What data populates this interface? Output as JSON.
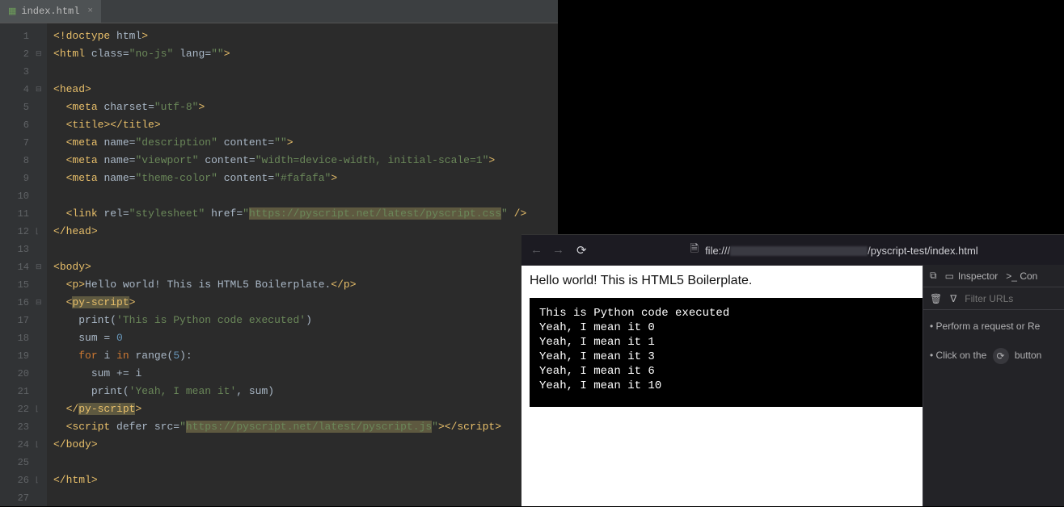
{
  "editor": {
    "tab": {
      "filename": "index.html"
    },
    "lines": [
      {
        "n": 1,
        "fold": "",
        "html": "<span class='tag-angle'>&lt;!</span><span class='tag-name'>doctype</span> <span class='attr-name'>html</span><span class='tag-angle'>&gt;</span>"
      },
      {
        "n": 2,
        "fold": "⊟",
        "html": "<span class='tag-angle'>&lt;</span><span class='tag-name'>html</span> <span class='attr-name'>class</span>=<span class='attr-val'>\"no-js\"</span> <span class='attr-name'>lang</span>=<span class='attr-val'>\"\"</span><span class='tag-angle'>&gt;</span>"
      },
      {
        "n": 3,
        "fold": "",
        "html": ""
      },
      {
        "n": 4,
        "fold": "⊟",
        "html": "<span class='tag-angle'>&lt;</span><span class='tag-name'>head</span><span class='tag-angle'>&gt;</span>"
      },
      {
        "n": 5,
        "fold": "",
        "html": "  <span class='tag-angle'>&lt;</span><span class='tag-name'>meta</span> <span class='attr-name'>charset</span>=<span class='attr-val'>\"utf-8\"</span><span class='tag-angle'>&gt;</span>"
      },
      {
        "n": 6,
        "fold": "",
        "html": "  <span class='tag-angle'>&lt;</span><span class='tag-name'>title</span><span class='tag-angle'>&gt;&lt;/</span><span class='tag-name'>title</span><span class='tag-angle'>&gt;</span>"
      },
      {
        "n": 7,
        "fold": "",
        "html": "  <span class='tag-angle'>&lt;</span><span class='tag-name'>meta</span> <span class='attr-name'>name</span>=<span class='attr-val'>\"description\"</span> <span class='attr-name'>content</span>=<span class='attr-val'>\"\"</span><span class='tag-angle'>&gt;</span>"
      },
      {
        "n": 8,
        "fold": "",
        "html": "  <span class='tag-angle'>&lt;</span><span class='tag-name'>meta</span> <span class='attr-name'>name</span>=<span class='attr-val'>\"viewport\"</span> <span class='attr-name'>content</span>=<span class='attr-val'>\"width=device-width, initial-scale=1\"</span><span class='tag-angle'>&gt;</span>"
      },
      {
        "n": 9,
        "fold": "",
        "html": "  <span class='tag-angle'>&lt;</span><span class='tag-name'>meta</span> <span class='attr-name'>name</span>=<span class='attr-val'>\"theme-color\"</span> <span class='attr-name'>content</span>=<span class='attr-val'>\"#fafafa\"</span><span class='tag-angle'>&gt;</span>"
      },
      {
        "n": 10,
        "fold": "",
        "html": ""
      },
      {
        "n": 11,
        "fold": "",
        "html": "  <span class='tag-angle'>&lt;</span><span class='tag-name'>link</span> <span class='attr-name'>rel</span>=<span class='attr-val'>\"stylesheet\"</span> <span class='attr-name'>href</span>=<span class='attr-val'>\"<span class='hl-soft'>https://pyscript.net/latest/pyscript.css</span>\"</span> <span class='tag-angle'>/&gt;</span>"
      },
      {
        "n": 12,
        "fold": "⌊",
        "html": "<span class='tag-angle'>&lt;/</span><span class='tag-name'>head</span><span class='tag-angle'>&gt;</span>"
      },
      {
        "n": 13,
        "fold": "",
        "html": ""
      },
      {
        "n": 14,
        "fold": "⊟",
        "html": "<span class='tag-angle'>&lt;</span><span class='tag-name'>body</span><span class='tag-angle'>&gt;</span>"
      },
      {
        "n": 15,
        "fold": "",
        "html": "  <span class='tag-angle'>&lt;</span><span class='tag-name'>p</span><span class='tag-angle'>&gt;</span><span class='text-node'>Hello world! This is HTML5 Boilerplate.</span><span class='tag-angle'>&lt;/</span><span class='tag-name'>p</span><span class='tag-angle'>&gt;</span>"
      },
      {
        "n": 16,
        "fold": "⊟",
        "html": "  <span class='tag-angle'>&lt;</span><span class='custom-tag'>py-script</span><span class='tag-angle'>&gt;</span>"
      },
      {
        "n": 17,
        "fold": "",
        "html": "    <span class='py-id'>print</span>(<span class='py-str'>'This is Python code executed'</span>)"
      },
      {
        "n": 18,
        "fold": "",
        "html": "    <span class='py-id'>sum</span> = <span class='py-num'>0</span>"
      },
      {
        "n": 19,
        "fold": "",
        "html": "    <span class='py-kw'>for</span> <span class='py-id'>i</span> <span class='py-kw'>in</span> <span class='py-id'>range</span>(<span class='py-num'>5</span>):"
      },
      {
        "n": 20,
        "fold": "",
        "html": "      <span class='py-id'>sum</span> += <span class='py-id'>i</span>"
      },
      {
        "n": 21,
        "fold": "",
        "html": "      <span class='py-id'>print</span>(<span class='py-str'>'Yeah, I mean it'</span>, <span class='py-id'>sum</span>)"
      },
      {
        "n": 22,
        "fold": "⌊",
        "html": "  <span class='tag-angle'>&lt;/</span><span class='custom-tag'>py-script</span><span class='tag-angle'>&gt;</span>"
      },
      {
        "n": 23,
        "fold": "",
        "html": "  <span class='tag-angle'>&lt;</span><span class='tag-name'>script</span> <span class='attr-name'>defer</span> <span class='attr-name'>src</span>=<span class='attr-val'>\"<span class='hl-soft'>https://pyscript.net/latest/pyscript.js</span>\"</span><span class='tag-angle'>&gt;&lt;/</span><span class='tag-name'>script</span><span class='tag-angle'>&gt;</span>"
      },
      {
        "n": 24,
        "fold": "⌊",
        "html": "<span class='tag-angle'>&lt;/</span><span class='tag-name'>body</span><span class='tag-angle'>&gt;</span>"
      },
      {
        "n": 25,
        "fold": "",
        "html": ""
      },
      {
        "n": 26,
        "fold": "⌊",
        "html": "<span class='tag-angle'>&lt;/</span><span class='tag-name'>html</span><span class='tag-angle'>&gt;</span>"
      },
      {
        "n": 27,
        "fold": "",
        "html": ""
      }
    ]
  },
  "browser": {
    "url_prefix": "file:///",
    "url_suffix": "/pyscript-test/index.html",
    "page_heading": "Hello world! This is HTML5 Boilerplate.",
    "output_lines": [
      "This is Python code executed",
      "Yeah, I mean it 0",
      "Yeah, I mean it 1",
      "Yeah, I mean it 3",
      "Yeah, I mean it 6",
      "Yeah, I mean it 10"
    ]
  },
  "devtools": {
    "tab_inspector": "Inspector",
    "tab_con": "Con",
    "filter_placeholder": "Filter URLs",
    "hint1_pre": "Perform a request or ",
    "hint1_post": "Re",
    "hint2_pre": "Click on the ",
    "hint2_post": "button"
  }
}
